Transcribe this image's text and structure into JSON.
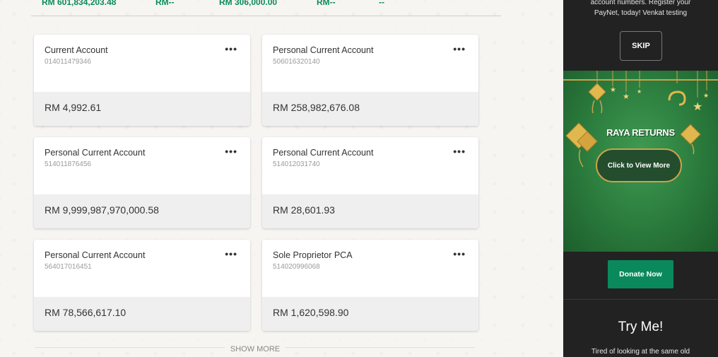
{
  "summary": {
    "values": [
      "RM 601,834,203.48",
      "RM--",
      "RM 306,000.00",
      "RM--",
      "--"
    ]
  },
  "accounts": [
    {
      "name": "Current Account",
      "number": "014011479346",
      "balance": "RM 4,992.61",
      "menu": "•••"
    },
    {
      "name": "Personal Current Account",
      "number": "506016320140",
      "balance": "RM 258,982,676.08",
      "menu": "•••"
    },
    {
      "name": "Personal Current Account",
      "number": "514011876456",
      "balance": "RM 9,999,987,970,000.58",
      "menu": "•••"
    },
    {
      "name": "Personal Current Account",
      "number": "514012031740",
      "balance": "RM 28,601.93",
      "menu": "•••"
    },
    {
      "name": "Personal Current Account",
      "number": "564017016451",
      "balance": "RM 78,566,617.10",
      "menu": "•••"
    },
    {
      "name": "Sole Proprietor PCA",
      "number": "514020996068",
      "balance": "RM 1,620,598.90",
      "menu": "•••"
    }
  ],
  "show_more": "SHOW MORE",
  "sidebar": {
    "promo_text_line1": "account numbers. Register your",
    "promo_text_line2": "PayNet, today! Venkat testing",
    "skip_label": "SKIP",
    "banner_title": "RAYA RETURNS",
    "banner_cta": "Click to View More",
    "donate_label": "Donate Now",
    "tryme_title": "Try Me!",
    "tryme_text": "Tired of looking at the same old"
  },
  "colors": {
    "accent": "#0a8a5c",
    "sidebar_bg": "#222222",
    "banner_green": "#2a7a3c",
    "gold": "#c9a44a"
  }
}
